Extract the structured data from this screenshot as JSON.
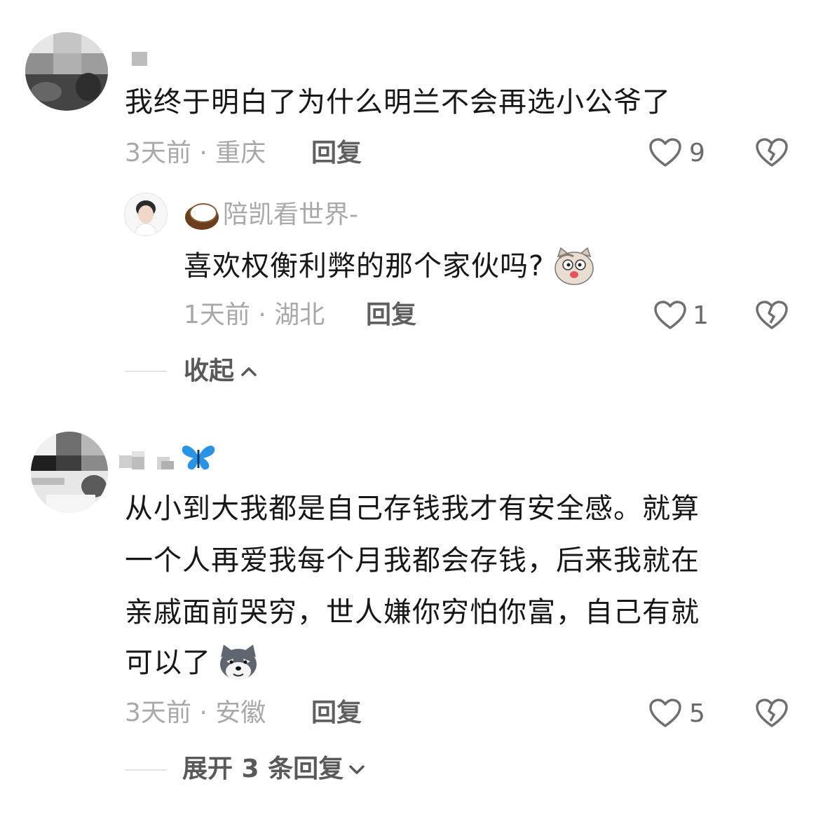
{
  "comments": [
    {
      "body": "我终于明白了为什么明兰不会再选小公爷了",
      "meta": "3天前 · 重庆",
      "reply_label": "回复",
      "likes": "9",
      "replies": [
        {
          "username": "陪凯看世界-",
          "body": "喜欢权衡利弊的那个家伙吗?",
          "meta": "1天前 · 湖北",
          "reply_label": "回复",
          "likes": "1"
        }
      ],
      "toggle_label": "收起"
    },
    {
      "body_lines": [
        "从小到大我都是自己存钱我才有安全感。就算",
        "一个人再爱我每个月我都会存钱，后来我就在",
        "亲戚面前哭穷，世人嫌你穷怕你富，自己有就",
        "可以了"
      ],
      "meta": "3天前 · 安徽",
      "reply_label": "回复",
      "likes": "5",
      "toggle_label": "展开 3 条回复"
    }
  ],
  "icons": {
    "like": "heart-outline-icon",
    "dislike": "broken-heart-icon",
    "collapse": "chevron-up-icon",
    "expand": "chevron-down-icon",
    "emoji1": "cat-face-emoji",
    "emoji2": "husky-dog-emoji",
    "badge_user": "coconut-icon",
    "badge_user2": "butterfly-icon"
  },
  "colors": {
    "text": "#171717",
    "meta": "#a8a8a8",
    "reply": "#5f5f5f"
  }
}
